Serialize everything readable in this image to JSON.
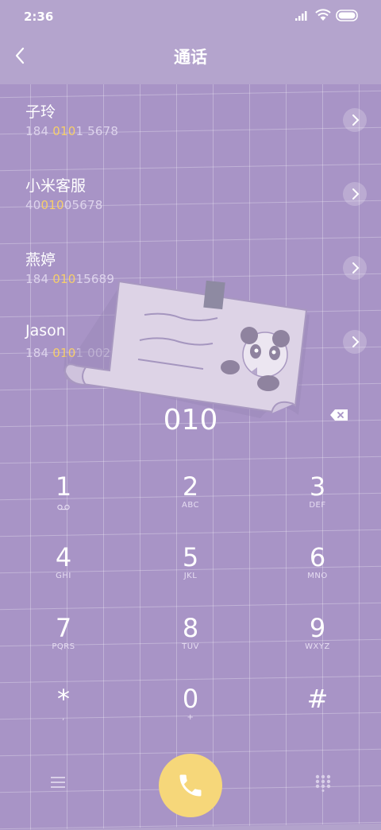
{
  "status_bar": {
    "time": "2:36"
  },
  "header": {
    "title": "通话"
  },
  "contacts": [
    {
      "name": "子玲",
      "num_pre": "184 ",
      "num_hl": "010",
      "num_post": "1 5678"
    },
    {
      "name": "小米客服",
      "num_pre": "40",
      "num_hl": "010",
      "num_post": "05678"
    },
    {
      "name": "燕婷",
      "num_pre": "184 ",
      "num_hl": "010",
      "num_post": "15689"
    },
    {
      "name": "Jason",
      "num_pre": "184 ",
      "num_hl": "010",
      "num_post": "1 0029"
    }
  ],
  "dialer": {
    "entered_number": "010"
  },
  "keys": [
    {
      "digit": "1",
      "sub": ""
    },
    {
      "digit": "2",
      "sub": "ABC"
    },
    {
      "digit": "3",
      "sub": "DEF"
    },
    {
      "digit": "4",
      "sub": "GHI"
    },
    {
      "digit": "5",
      "sub": "JKL"
    },
    {
      "digit": "6",
      "sub": "MNO"
    },
    {
      "digit": "7",
      "sub": "PQRS"
    },
    {
      "digit": "8",
      "sub": "TUV"
    },
    {
      "digit": "9",
      "sub": "WXYZ"
    },
    {
      "digit": "*",
      "sub": ","
    },
    {
      "digit": "0",
      "sub": "+"
    },
    {
      "digit": "#",
      "sub": ""
    }
  ],
  "colors": {
    "background": "#a894c6",
    "highlight": "#f6cf6a",
    "call_button": "#f6d77a"
  },
  "icons": {
    "back": "chevron-left-icon",
    "delete": "backspace-icon",
    "call": "phone-icon",
    "menu": "menu-icon",
    "dialpad": "dialpad-icon",
    "contact_detail": "chevron-right-icon"
  }
}
